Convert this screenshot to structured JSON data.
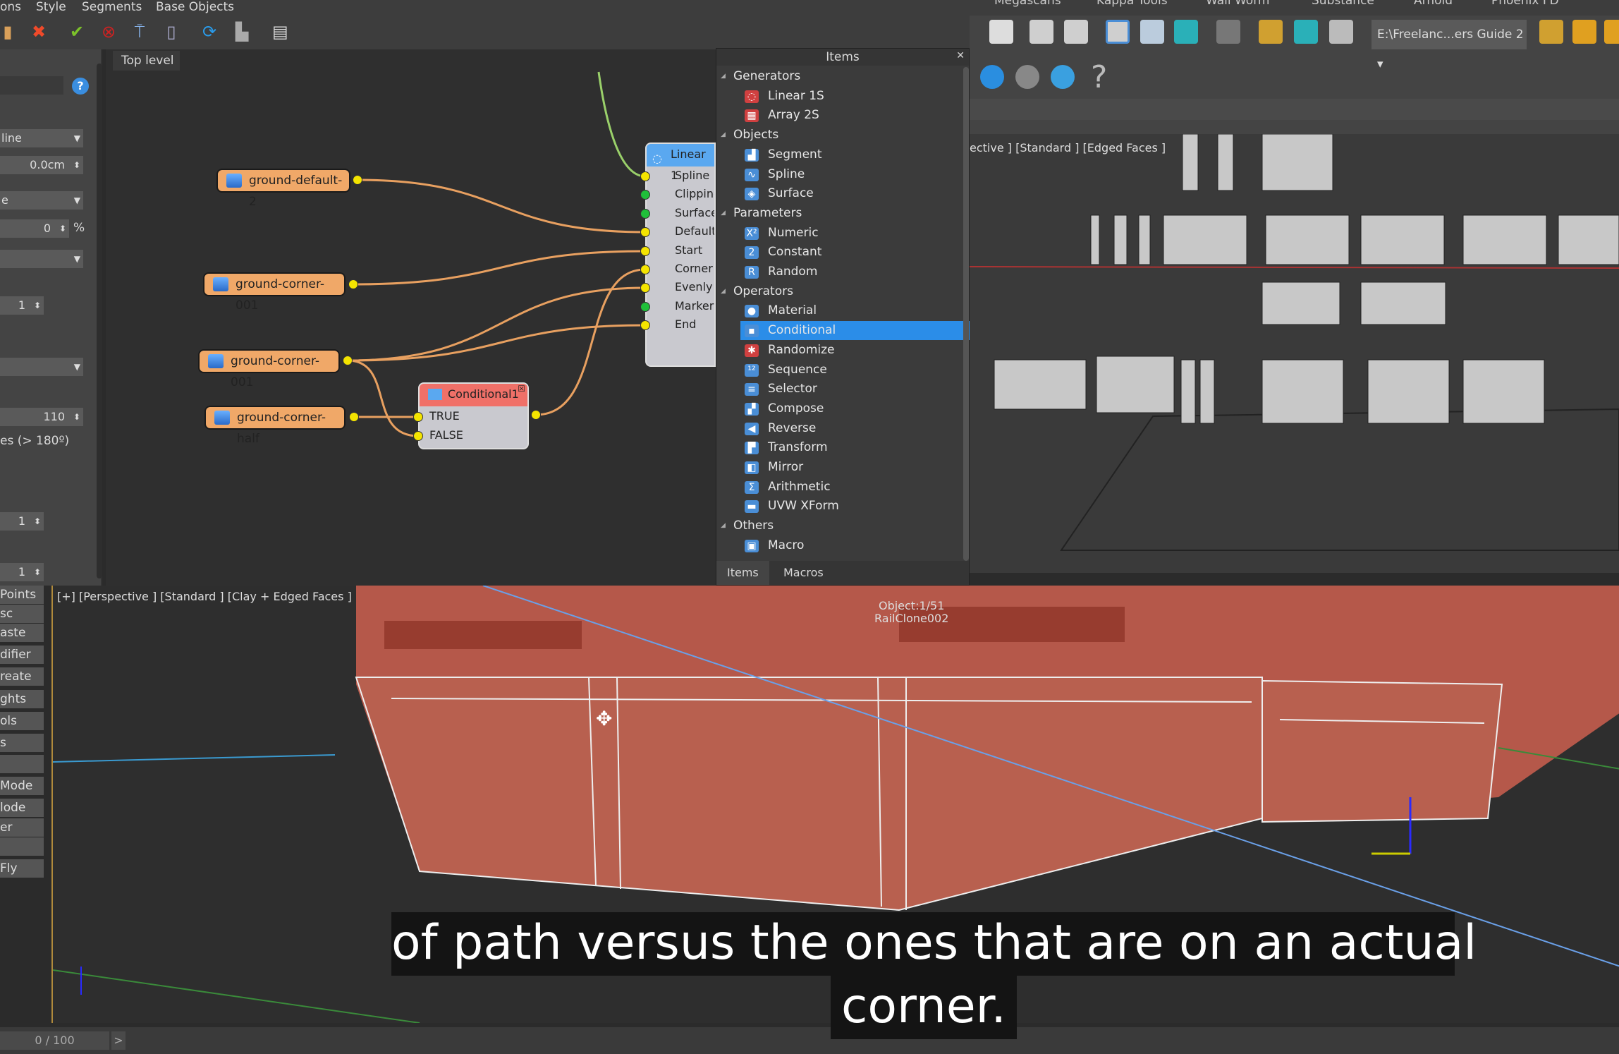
{
  "menubar": {
    "items": [
      "ons",
      "Style",
      "Segments",
      "Base Objects"
    ],
    "right_items": [
      "Megascans",
      "Kappa Tools",
      "Wall Worm",
      "Substance",
      "Arnold",
      "Phoenix FD"
    ]
  },
  "toolbar": {
    "icons": [
      "library-icon",
      "delete-icon",
      "apply-icon",
      "stop-icon",
      "move-up-icon",
      "move-down-icon",
      "refresh-icon",
      "export-icon",
      "panel-icon"
    ]
  },
  "left_panel": {
    "fields": [
      {
        "value": "line",
        "type": "dropdown"
      },
      {
        "value": "0.0cm",
        "type": "spinner"
      },
      {
        "value": "e",
        "type": "dropdown"
      },
      {
        "value": "0",
        "type": "spinner",
        "unit": "%"
      },
      {
        "value": "",
        "type": "dropdown"
      },
      {
        "value": "1",
        "type": "spinner"
      },
      {
        "value": "",
        "type": "dropdown"
      },
      {
        "value": "110",
        "type": "spinner"
      },
      {
        "value": "1",
        "type": "spinner"
      },
      {
        "value": "1",
        "type": "spinner"
      }
    ],
    "label_angle": "es (> 180º)"
  },
  "node_editor": {
    "tab": "Top level",
    "nodes": {
      "n1": "ground-default-2",
      "n2": "ground-corner-001",
      "n3": "ground-corner-001",
      "n4": "ground-corner-half",
      "conditional": {
        "title": "Conditional1",
        "inputs": [
          "TRUE",
          "FALSE"
        ]
      },
      "linear": {
        "title": "Linear 1",
        "inputs": [
          "Spline",
          "Clipping",
          "Surface",
          "Default",
          "Start",
          "Corner",
          "Evenly",
          "Marker",
          "End"
        ]
      }
    }
  },
  "items_panel": {
    "title": "Items",
    "rows": [
      {
        "type": "cat",
        "label": "Generators"
      },
      {
        "type": "sub",
        "label": "Linear 1S",
        "icon": "linear-icon"
      },
      {
        "type": "sub",
        "label": "Array 2S",
        "icon": "array-icon"
      },
      {
        "type": "cat",
        "label": "Objects"
      },
      {
        "type": "sub",
        "label": "Segment",
        "icon": "segment-icon"
      },
      {
        "type": "sub",
        "label": "Spline",
        "icon": "spline-icon"
      },
      {
        "type": "sub",
        "label": "Surface",
        "icon": "surface-icon"
      },
      {
        "type": "cat",
        "label": "Parameters"
      },
      {
        "type": "sub",
        "label": "Numeric",
        "icon": "numeric-icon"
      },
      {
        "type": "sub",
        "label": "Constant",
        "icon": "constant-icon"
      },
      {
        "type": "sub",
        "label": "Random",
        "icon": "random-icon"
      },
      {
        "type": "cat",
        "label": "Operators"
      },
      {
        "type": "sub",
        "label": "Material",
        "icon": "material-icon"
      },
      {
        "type": "sub",
        "label": "Conditional",
        "icon": "conditional-icon",
        "selected": true
      },
      {
        "type": "sub",
        "label": "Randomize",
        "icon": "randomize-icon"
      },
      {
        "type": "sub",
        "label": "Sequence",
        "icon": "sequence-icon"
      },
      {
        "type": "sub",
        "label": "Selector",
        "icon": "selector-icon"
      },
      {
        "type": "sub",
        "label": "Compose",
        "icon": "compose-icon"
      },
      {
        "type": "sub",
        "label": "Reverse",
        "icon": "reverse-icon"
      },
      {
        "type": "sub",
        "label": "Transform",
        "icon": "transform-icon"
      },
      {
        "type": "sub",
        "label": "Mirror",
        "icon": "mirror-icon"
      },
      {
        "type": "sub",
        "label": "Arithmetic",
        "icon": "arithmetic-icon"
      },
      {
        "type": "sub",
        "label": "UVW XForm",
        "icon": "uvw-icon"
      },
      {
        "type": "cat",
        "label": "Others"
      },
      {
        "type": "sub",
        "label": "Macro",
        "icon": "macro-icon"
      }
    ],
    "tabs": [
      "Items",
      "Macros"
    ]
  },
  "right_toolbar": {
    "project_path": "E:\\Freelanc...ers Guide 2"
  },
  "viewport_top": {
    "label": "ective ] [Standard ] [Edged Faces ]"
  },
  "viewport_bottom": {
    "label": "[+] [Perspective ] [Standard ] [Clay + Edged Faces ]",
    "object_info": "Object:1/51",
    "object_name": "RailClone002"
  },
  "command_list": [
    "Points",
    "sc",
    "aste",
    "difier",
    "reate",
    "ghts",
    "ols",
    "s",
    "",
    "Mode",
    "lode",
    "er",
    "",
    "Fly"
  ],
  "timeline": {
    "frame": "0 / 100",
    "next": ">"
  },
  "subtitle": {
    "line1": "of path versus the ones that are on an actual",
    "line2": "corner."
  },
  "colors": {
    "selection": "#2b8de8",
    "node_segment": "#f0a868",
    "node_conditional": "#f07068",
    "node_linear": "#5aa8f0",
    "wire": "#e8a060",
    "port": "#f4e400",
    "model": "#b5584a"
  }
}
